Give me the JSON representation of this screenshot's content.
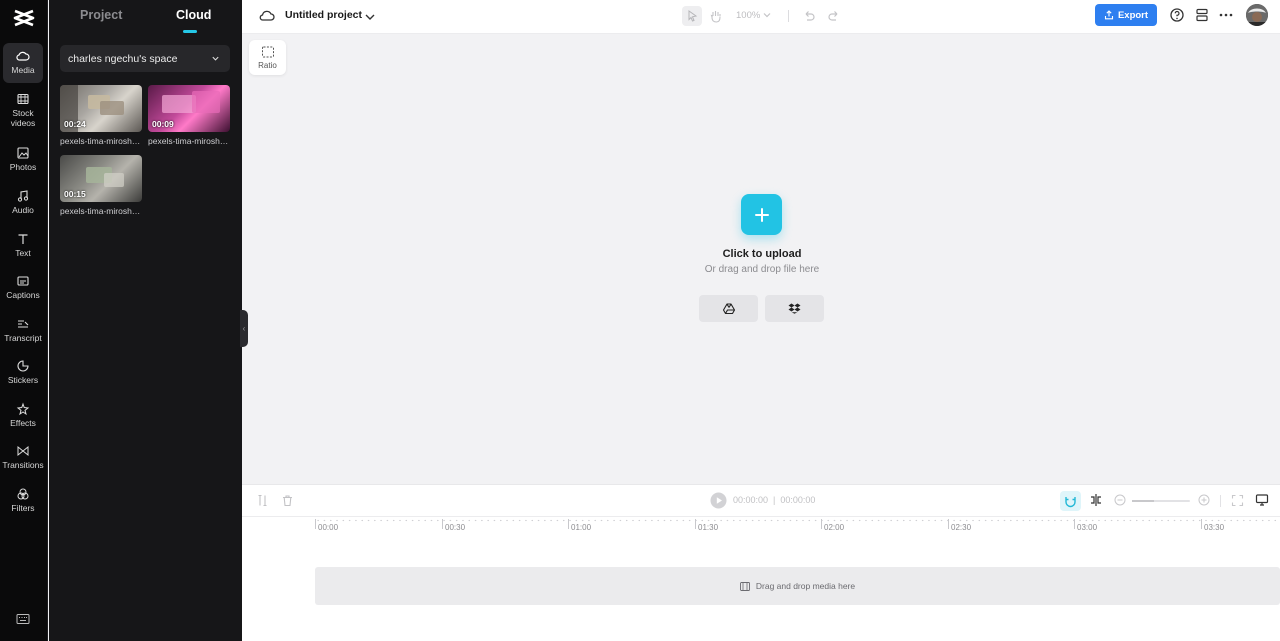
{
  "rail": {
    "items": [
      {
        "label": "Media",
        "icon": "cloud-icon"
      },
      {
        "label": "Stock videos",
        "icon": "film-icon"
      },
      {
        "label": "Photos",
        "icon": "image-icon"
      },
      {
        "label": "Audio",
        "icon": "music-icon"
      },
      {
        "label": "Text",
        "icon": "text-icon"
      },
      {
        "label": "Captions",
        "icon": "captions-icon"
      },
      {
        "label": "Transcript",
        "icon": "transcript-icon"
      },
      {
        "label": "Stickers",
        "icon": "sticker-icon"
      },
      {
        "label": "Effects",
        "icon": "effects-icon"
      },
      {
        "label": "Transitions",
        "icon": "transitions-icon"
      },
      {
        "label": "Filters",
        "icon": "filters-icon"
      }
    ]
  },
  "panel": {
    "tabs": [
      "Project",
      "Cloud"
    ],
    "active_tab": "Cloud",
    "space": "charles ngechu's space",
    "media": [
      {
        "duration": "00:24",
        "name": "pexels-tima-miroshnichenko"
      },
      {
        "duration": "00:09",
        "name": "pexels-tima-miroshnichenko"
      },
      {
        "duration": "00:15",
        "name": "pexels-tima-miroshnichenko"
      }
    ]
  },
  "topbar": {
    "project_title": "Untitled project",
    "zoom": "100%",
    "export_label": "Export"
  },
  "canvas": {
    "ratio_label": "Ratio",
    "upload_title": "Click to upload",
    "upload_sub": "Or drag and drop file here"
  },
  "timeline": {
    "current_time": "00:00:00",
    "total_time": "00:00:00",
    "ruler": [
      "00:00",
      "00:30",
      "01:00",
      "01:30",
      "02:00",
      "02:30",
      "03:00",
      "03:30"
    ],
    "drop_text": "Drag and drop media here"
  },
  "colors": {
    "accent": "#22c3e4",
    "export": "#2e7ff0",
    "rail_bg": "#0a0a0b",
    "panel_bg": "#161618"
  }
}
